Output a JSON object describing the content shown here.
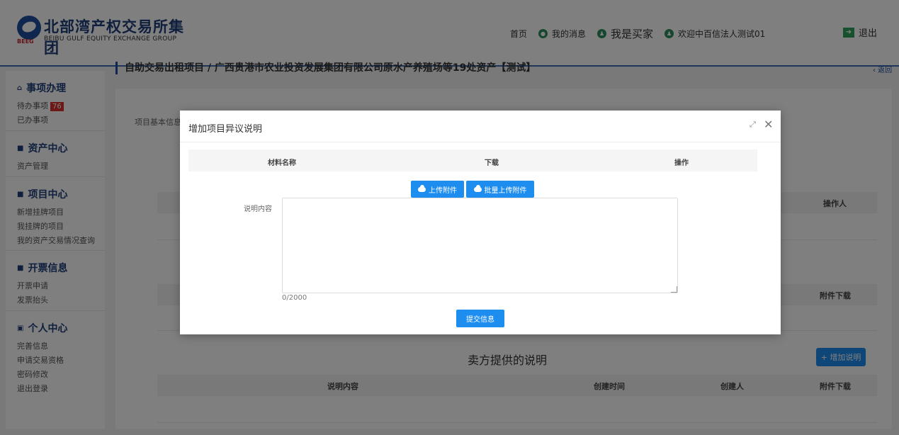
{
  "header": {
    "logo_mark_text": "BEEG",
    "logo_title": "北部湾产权交易所集团",
    "logo_subtitle": "BEIBU GULF EQUITY EXCHANGE GROUP",
    "nav": {
      "home": "首页",
      "messages": "我的消息",
      "buyer": "我是买家",
      "welcome": "欢迎中百信法人测试01",
      "logout": "退出"
    }
  },
  "sidebar": {
    "groups": [
      {
        "title": "事项办理",
        "icon": "home-icon",
        "items": [
          "待办事项",
          "已办事项"
        ],
        "badge": "76"
      },
      {
        "title": "资产中心",
        "icon": "grid-icon",
        "items": [
          "资产管理"
        ]
      },
      {
        "title": "项目中心",
        "icon": "grid-icon",
        "items": [
          "新增挂牌项目",
          "我挂牌的项目",
          "我的资产交易情况查询"
        ]
      },
      {
        "title": "开票信息",
        "icon": "grid-icon",
        "items": [
          "开票申请",
          "发票抬头"
        ]
      },
      {
        "title": "个人中心",
        "icon": "user-card-icon",
        "items": [
          "完善信息",
          "申请交易资格",
          "密码修改",
          "退出登录"
        ]
      }
    ]
  },
  "page": {
    "title": "自助交易出租项目 / 广西贵港市农业投资发展集团有限公司原水产养殖场等19处资产【测试】",
    "back": "‹ 返回",
    "tab_basic": "项目基本信息",
    "col_operator": "操作人",
    "col_attachment_download": "附件下载",
    "seller_section_title": "卖方提供的说明",
    "add_note_button": "+ 增加说明",
    "seller_table": {
      "columns": [
        "说明内容",
        "创建时间",
        "创建人",
        "附件下载"
      ]
    }
  },
  "modal": {
    "title": "增加项目异议说明",
    "table_columns": [
      "材料名称",
      "下载",
      "操作"
    ],
    "upload_button": "上传附件",
    "batch_upload_button": "批量上传附件",
    "desc_label": "说明内容",
    "desc_value": "",
    "char_count": "0/2000",
    "submit_button": "提交信息"
  }
}
